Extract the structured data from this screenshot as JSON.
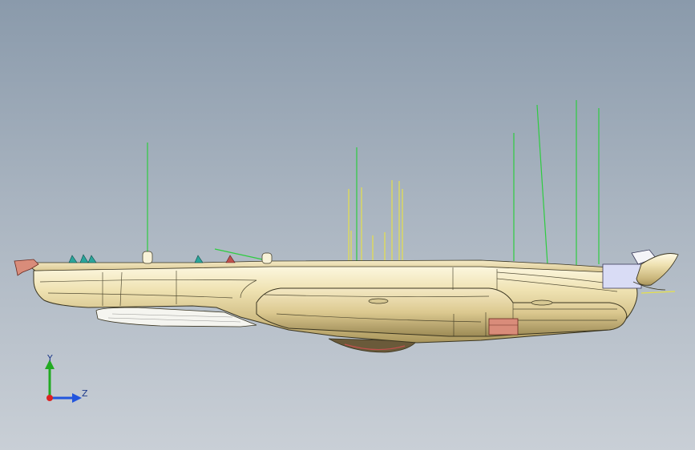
{
  "viewport": {
    "background_top": "#8a9aab",
    "background_bottom": "#c9cfd6"
  },
  "part": {
    "body_color": "#e8d9a8",
    "highlight_color": "#fffbe8",
    "shadow_color": "#a8955c",
    "edge_color": "#3a3520",
    "guide_line_green": "#2ecc40",
    "guide_line_yellow": "#e6e04a",
    "clip_color": "#2aa59a",
    "accent_red": "#c0504d",
    "block_color": "#d9dcf5"
  },
  "triad": {
    "y_label": "Y",
    "z_label": "Z",
    "y_color": "#22aa22",
    "z_color": "#2255dd",
    "origin_color": "#dd2222"
  }
}
